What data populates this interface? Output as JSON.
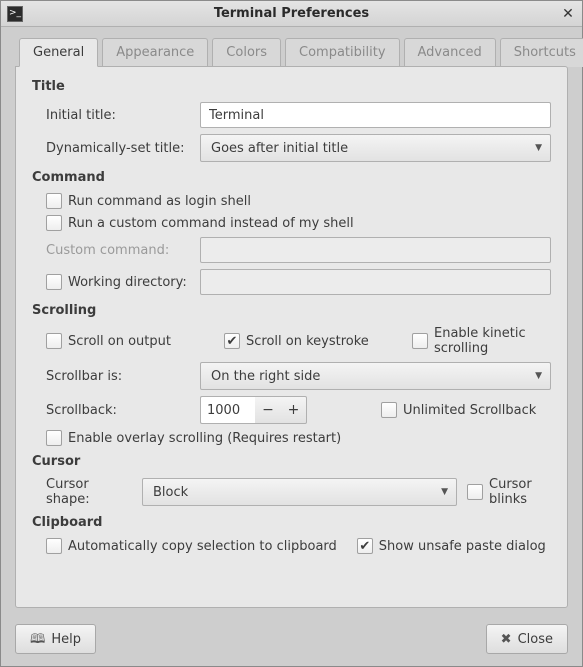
{
  "window": {
    "title": "Terminal Preferences"
  },
  "tabs": [
    "General",
    "Appearance",
    "Colors",
    "Compatibility",
    "Advanced",
    "Shortcuts"
  ],
  "title_section": {
    "heading": "Title",
    "initial_title_label": "Initial title:",
    "initial_title_value": "Terminal",
    "dyn_title_label": "Dynamically-set title:",
    "dyn_title_value": "Goes after initial title"
  },
  "command_section": {
    "heading": "Command",
    "login_shell": "Run command as login shell",
    "custom_cmd_check": "Run a custom command instead of my shell",
    "custom_cmd_label": "Custom command:",
    "custom_cmd_value": "",
    "working_dir_label": "Working directory:",
    "working_dir_value": ""
  },
  "scrolling_section": {
    "heading": "Scrolling",
    "scroll_output": "Scroll on output",
    "scroll_keystroke": "Scroll on keystroke",
    "kinetic": "Enable kinetic scrolling",
    "scrollbar_label": "Scrollbar is:",
    "scrollbar_value": "On the right side",
    "scrollback_label": "Scrollback:",
    "scrollback_value": "1000",
    "unlimited": "Unlimited Scrollback",
    "overlay": "Enable overlay scrolling (Requires restart)"
  },
  "cursor_section": {
    "heading": "Cursor",
    "shape_label": "Cursor shape:",
    "shape_value": "Block",
    "blinks": "Cursor blinks"
  },
  "clipboard_section": {
    "heading": "Clipboard",
    "autocopy": "Automatically copy selection to clipboard",
    "unsafe": "Show unsafe paste dialog"
  },
  "footer": {
    "help": "Help",
    "close": "Close"
  }
}
